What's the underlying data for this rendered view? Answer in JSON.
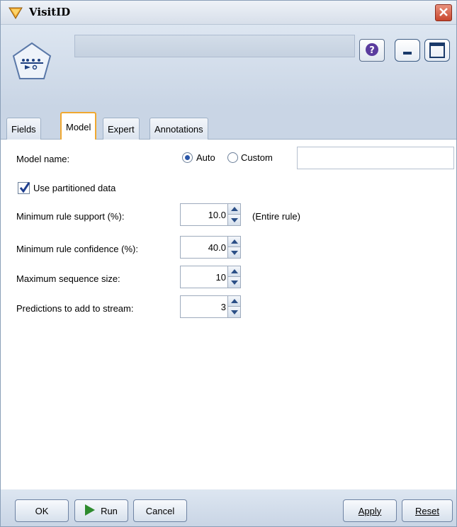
{
  "window": {
    "title": "VisitID",
    "close_label": "X"
  },
  "header": {
    "help_label": "?"
  },
  "tabs": [
    {
      "label": "Fields",
      "active": false
    },
    {
      "label": "Model",
      "active": true
    },
    {
      "label": "Expert",
      "active": false
    },
    {
      "label": "Annotations",
      "active": false
    }
  ],
  "model": {
    "model_name_label": "Model name:",
    "auto_label": "Auto",
    "custom_label": "Custom",
    "selected_option": "Auto",
    "custom_value": "",
    "use_partitioned_label": "Use partitioned data",
    "use_partitioned_checked": true,
    "min_support_label": "Minimum rule support (%):",
    "min_support_value": "10.0",
    "min_support_note": "(Entire rule)",
    "min_confidence_label": "Minimum rule confidence (%):",
    "min_confidence_value": "40.0",
    "max_sequence_label": "Maximum sequence size:",
    "max_sequence_value": "10",
    "predictions_label": "Predictions to add to stream:",
    "predictions_value": "3"
  },
  "footer": {
    "ok_label": "OK",
    "run_label": "Run",
    "cancel_label": "Cancel",
    "apply_label": "Apply",
    "reset_label": "Reset"
  },
  "colors": {
    "accent_tab": "#f0a830",
    "header_bg": "#c9d5e5",
    "close_red": "#c8462c",
    "run_green": "#2e8b2e",
    "check_blue": "#1f3f8f"
  }
}
